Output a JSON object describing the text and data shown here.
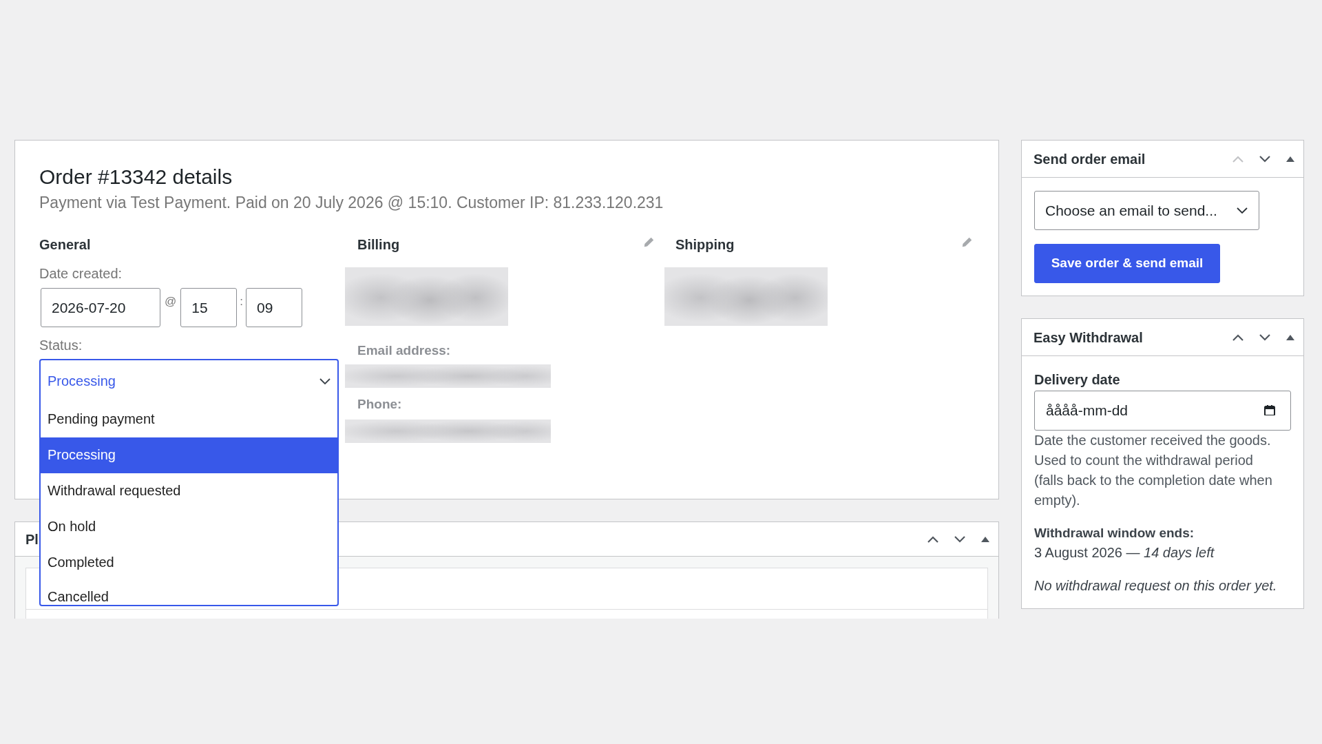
{
  "order_panel": {
    "title": "Order #13342 details",
    "subtitle": "Payment via Test Payment. Paid on 20 July 2026 @ 15:10. Customer IP: 81.233.120.231",
    "general": {
      "heading": "General",
      "date_created": {
        "label": "Date created:",
        "date": "2026-07-20",
        "at": "@",
        "hour": "15",
        "colon": ":",
        "minute": "09"
      },
      "status": {
        "label": "Status:",
        "value": "Processing",
        "expanded": true,
        "options": [
          {
            "label": "Pending payment",
            "selected": false
          },
          {
            "label": "Processing",
            "selected": true
          },
          {
            "label": "Withdrawal requested",
            "selected": false
          },
          {
            "label": "On hold",
            "selected": false
          },
          {
            "label": "Completed",
            "selected": false
          },
          {
            "label": "Cancelled",
            "selected": false
          }
        ]
      }
    },
    "billing": {
      "heading": "Billing",
      "email_label": "Email address:",
      "phone_label": "Phone:"
    },
    "shipping": {
      "heading": "Shipping"
    }
  },
  "lower_panel": {
    "title": "Pl",
    "move_up_disabled": false
  },
  "sidebar": [
    {
      "kind": "email",
      "title": "Send order email",
      "move_up_disabled": true,
      "select": {
        "value": "Choose an email to send..."
      },
      "button": "Save order & send email"
    },
    {
      "kind": "withdrawal",
      "title": "Easy Withdrawal",
      "move_up_disabled": false,
      "delivery_date": {
        "label": "Delivery date",
        "placeholder": "åååå-mm-dd"
      },
      "help": "Date the customer received the goods. Used to count the withdrawal period (falls back to the completion date when empty).",
      "window_label": "Withdrawal window ends:",
      "window_value": "3 August 2026 — *14 days left*",
      "note": "No withdrawal request on this order yet."
    }
  ]
}
